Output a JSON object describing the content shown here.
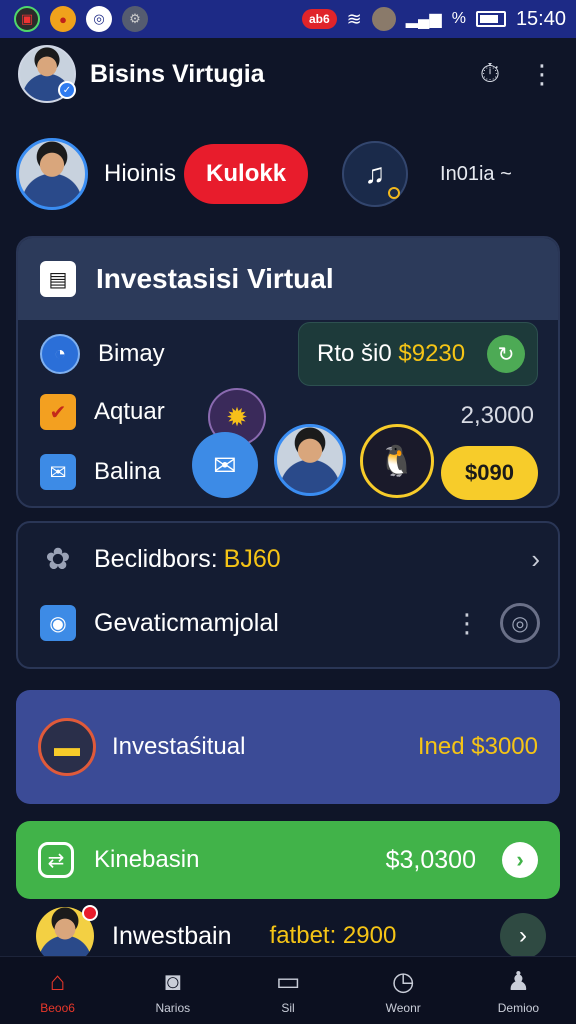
{
  "status_bar": {
    "badge": "ab6",
    "signal": "%",
    "time": "15:40"
  },
  "header": {
    "title": "Bisins Virtugia"
  },
  "profile": {
    "name": "Hioinis",
    "pill": "Kulokk",
    "language": "In01ia ~"
  },
  "invest_card": {
    "title": "Investasisi Virtual",
    "balance_prefix": "Rto ši0",
    "balance_value": "$9230",
    "rows": [
      {
        "label": "Bimay"
      },
      {
        "label": "Aqtuar"
      },
      {
        "label": "Balina"
      }
    ],
    "side_value": "2,3000",
    "action_pill": "$090"
  },
  "list_card": {
    "row1_label": "Beclidbors:",
    "row1_value": "BJ60",
    "row2_label": "Gevaticmamjolal"
  },
  "promo_card": {
    "label": "Investaśitual",
    "value": "Ined $3000"
  },
  "green_card": {
    "label": "Kinebasin",
    "value": "$3,0300"
  },
  "investor_row": {
    "label": "Inwestbain",
    "value": "fatbet: 2900"
  },
  "bottom_nav": [
    {
      "label": "Beoo6",
      "icon": "home-icon",
      "active": true
    },
    {
      "label": "Narios",
      "icon": "camera-icon",
      "active": false
    },
    {
      "label": "Sil",
      "icon": "card-icon",
      "active": false
    },
    {
      "label": "Weonr",
      "icon": "clock-icon",
      "active": false
    },
    {
      "label": "Demioo",
      "icon": "user-icon",
      "active": false
    }
  ],
  "colors": {
    "accent_red": "#e81c2c",
    "gold": "#f7cc2a",
    "green": "#41b349",
    "indigo": "#3b4b96",
    "status_bar": "#1d2a86"
  }
}
